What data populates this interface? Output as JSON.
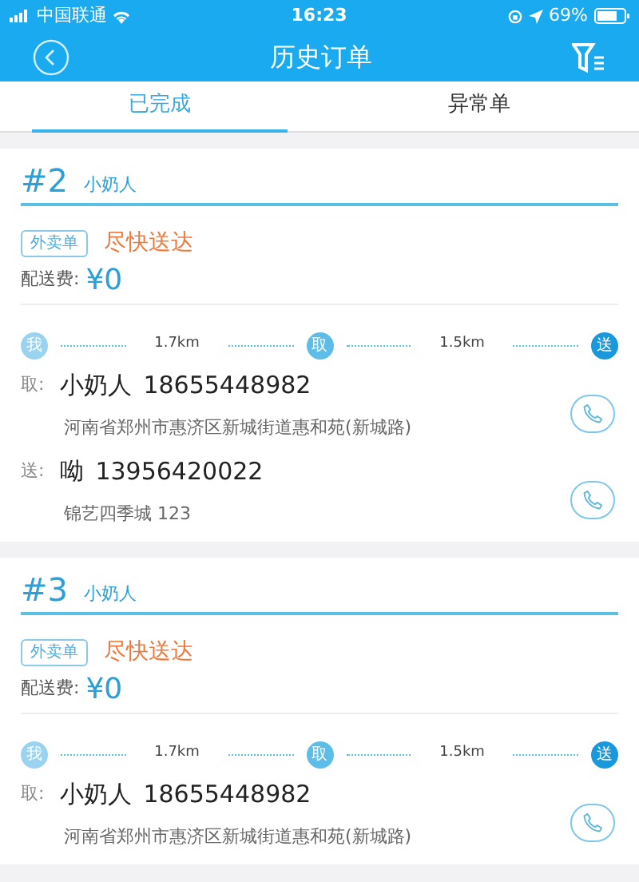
{
  "status_bar": {
    "carrier": "中国联通",
    "time": "16:23",
    "battery": "69%"
  },
  "nav": {
    "title": "历史订单"
  },
  "tabs": [
    {
      "label": "已完成",
      "selected": true
    },
    {
      "label": "异常单",
      "selected": false
    }
  ],
  "orders": [
    {
      "number": "#2",
      "shop": "小奶人",
      "tag": "外卖单",
      "urgency": "尽快送达",
      "fee_label": "配送费:",
      "fee": "¥0",
      "route": {
        "start": "我",
        "distance_1": "1.7km",
        "middle": "取",
        "distance_2": "1.5km",
        "end": "送"
      },
      "contacts": [
        {
          "label": "取:",
          "name": "小奶人",
          "phone": "18655448982",
          "address": "河南省郑州市惠济区新城街道惠和苑(新城路)"
        },
        {
          "label": "送:",
          "name": "呦",
          "phone": "13956420022",
          "address": "锦艺四季城 123"
        }
      ]
    },
    {
      "number": "#3",
      "shop": "小奶人",
      "tag": "外卖单",
      "urgency": "尽快送达",
      "fee_label": "配送费:",
      "fee": "¥0",
      "route": {
        "start": "我",
        "distance_1": "1.7km",
        "middle": "取",
        "distance_2": "1.5km",
        "end": "送"
      },
      "contacts": [
        {
          "label": "取:",
          "name": "小奶人",
          "phone": "18655448982",
          "address": "河南省郑州市惠济区新城街道惠和苑(新城路)"
        }
      ]
    }
  ]
}
